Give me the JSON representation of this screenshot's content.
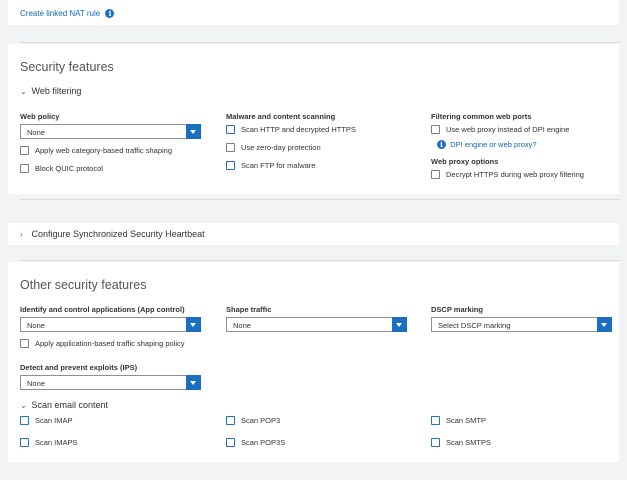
{
  "nat_link": {
    "label": "Create linked NAT rule",
    "icon": "info-icon"
  },
  "security": {
    "title": "Security features",
    "web_filtering": {
      "toggle": "Web filtering",
      "web_policy": {
        "label": "Web policy",
        "value": "None",
        "options": [
          "Apply web category-based traffic shaping",
          "Block QUIC protocol"
        ]
      },
      "malware": {
        "label": "Malware and content scanning",
        "options": [
          "Scan HTTP and decrypted HTTPS",
          "Use zero-day protection",
          "Scan FTP for malware"
        ]
      },
      "filtering_ports": {
        "label": "Filtering common web ports",
        "option": "Use web proxy instead of DPI engine",
        "help_link": "DPI engine or web proxy?"
      },
      "proxy_options": {
        "label": "Web proxy options",
        "option": "Decrypt HTTPS during web proxy filtering"
      }
    }
  },
  "heartbeat": {
    "toggle": "Configure Synchronized Security Heartbeat"
  },
  "other": {
    "title": "Other security features",
    "app_control": {
      "label": "Identify and control applications (App control)",
      "value": "None",
      "option": "Apply application-based traffic shaping policy"
    },
    "shape_traffic": {
      "label": "Shape traffic",
      "value": "None"
    },
    "dscp": {
      "label": "DSCP marking",
      "value": "Select DSCP marking"
    },
    "ips": {
      "label": "Detect and prevent exploits (IPS)",
      "value": "None"
    },
    "email": {
      "toggle": "Scan email content",
      "options": [
        "Scan IMAP",
        "Scan POP3",
        "Scan SMTP",
        "Scan IMAPS",
        "Scan POP3S",
        "Scan SMTPS"
      ]
    }
  },
  "colors": {
    "accent": "#1a6fc2",
    "link": "#1266b8",
    "background": "#f2f3f5"
  }
}
